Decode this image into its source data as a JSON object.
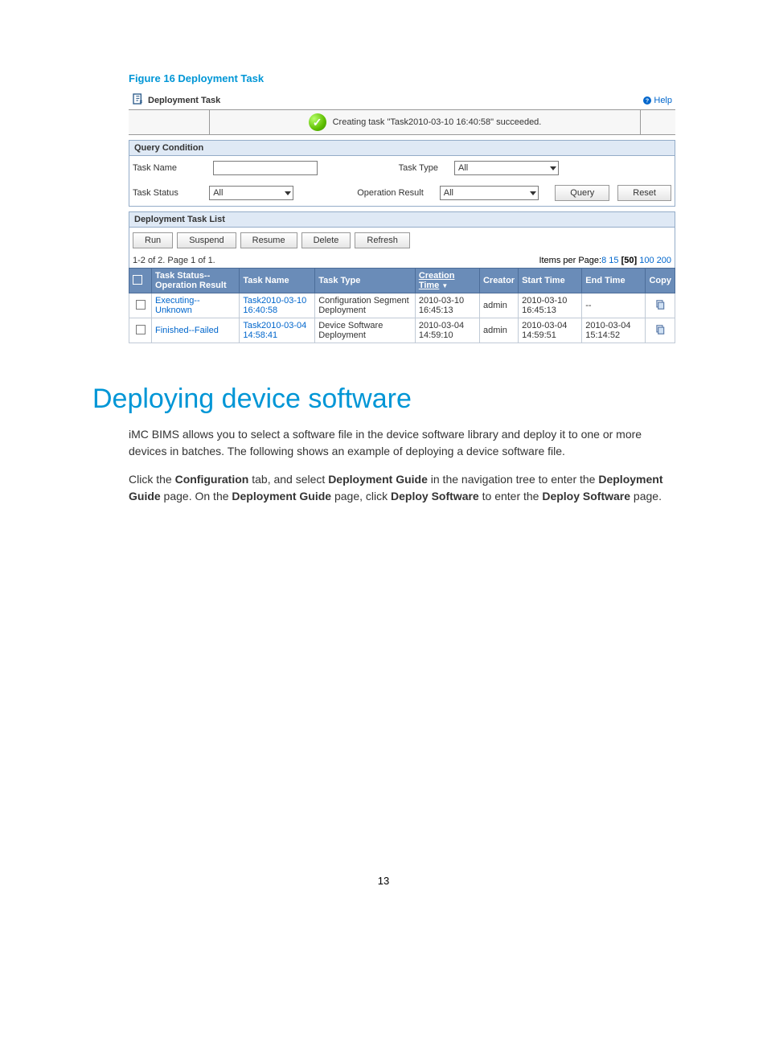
{
  "figure_caption": "Figure 16 Deployment Task",
  "header": {
    "title": "Deployment Task",
    "help": "Help"
  },
  "success_msg": "Creating task \"Task2010-03-10 16:40:58\" succeeded.",
  "query": {
    "section": "Query Condition",
    "task_name_label": "Task Name",
    "task_name_value": "",
    "task_type_label": "Task Type",
    "task_type_value": "All",
    "task_status_label": "Task Status",
    "task_status_value": "All",
    "op_result_label": "Operation Result",
    "op_result_value": "All",
    "query_btn": "Query",
    "reset_btn": "Reset"
  },
  "list": {
    "section": "Deployment Task List",
    "buttons": {
      "run": "Run",
      "suspend": "Suspend",
      "resume": "Resume",
      "delete": "Delete",
      "refresh": "Refresh"
    },
    "pagination_text": "1-2 of 2. Page 1 of 1.",
    "items_label": "Items per Page:",
    "items_options": [
      "8",
      "15",
      "50",
      "100",
      "200"
    ],
    "items_selected": "[50]",
    "columns": {
      "status": "Task Status--Operation Result",
      "name": "Task Name",
      "type": "Task Type",
      "ctime": "Creation Time",
      "creator": "Creator",
      "stime": "Start Time",
      "etime": "End Time",
      "copy": "Copy"
    },
    "rows": [
      {
        "status": "Executing--Unknown",
        "name": "Task2010-03-10 16:40:58",
        "type": "Configuration Segment Deployment",
        "ctime": "2010-03-10 16:45:13",
        "creator": "admin",
        "stime": "2010-03-10 16:45:13",
        "etime": "--"
      },
      {
        "status": "Finished--Failed",
        "name": "Task2010-03-04 14:58:41",
        "type": "Device Software Deployment",
        "ctime": "2010-03-04 14:59:10",
        "creator": "admin",
        "stime": "2010-03-04 14:59:51",
        "etime": "2010-03-04 15:14:52"
      }
    ]
  },
  "doc": {
    "h1": "Deploying device software",
    "p1": "iMC BIMS allows you to select a software file in the device software library and deploy it to one or more devices in batches. The following shows an example of deploying a device software file.",
    "p2_a": "Click the ",
    "p2_b": "Configuration",
    "p2_c": " tab, and select ",
    "p2_d": "Deployment Guide",
    "p2_e": " in the navigation tree to enter the ",
    "p2_f": "Deployment Guide",
    "p2_g": " page. On the ",
    "p2_h": "Deployment Guide",
    "p2_i": " page, click ",
    "p2_j": "Deploy Software",
    "p2_k": " to enter the ",
    "p2_l": "Deploy Software",
    "p2_m": " page."
  },
  "page_number": "13"
}
